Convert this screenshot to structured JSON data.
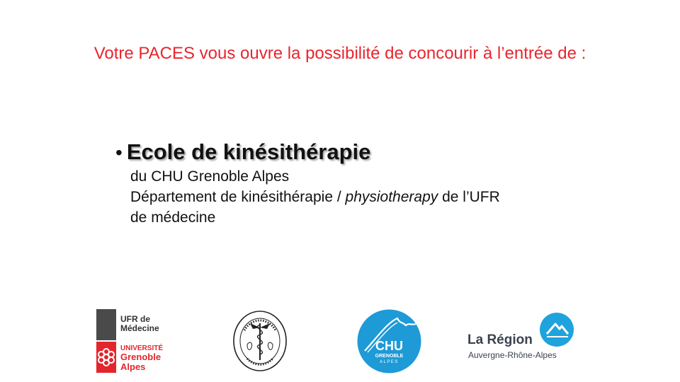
{
  "headline": "Votre PACES vous ouvre la possibilité de concourir à l’entrée de :",
  "item": {
    "bullet": "•",
    "title": "Ecole de kinésithérapie",
    "line1": "du CHU Grenoble Alpes",
    "line2_pre": "Département de kinésithérapie / ",
    "line2_italic": "physiotherapy",
    "line2_post": " de l’UFR",
    "line3": "de médecine"
  },
  "logos": {
    "ufr": {
      "line1": "UFR de",
      "line2": "Médecine",
      "univ": "UNIVERSITÉ",
      "city": "Grenoble",
      "region": "Alpes"
    },
    "seal": {
      "text": "ECOLE DE KINESITHERAPIE",
      "bottom": "C.H.U. GRENOBLE"
    },
    "chu": {
      "name": "CHU",
      "city": "GRENOBLE",
      "region": "ALPES"
    },
    "region": {
      "name": "La Région",
      "sub": "Auvergne-Rhône-Alpes"
    }
  },
  "colors": {
    "headline": "#e8262d",
    "ufr_red": "#e3262d",
    "chu_blue": "#1e9ad6",
    "region_blue": "#1ea3dc"
  }
}
